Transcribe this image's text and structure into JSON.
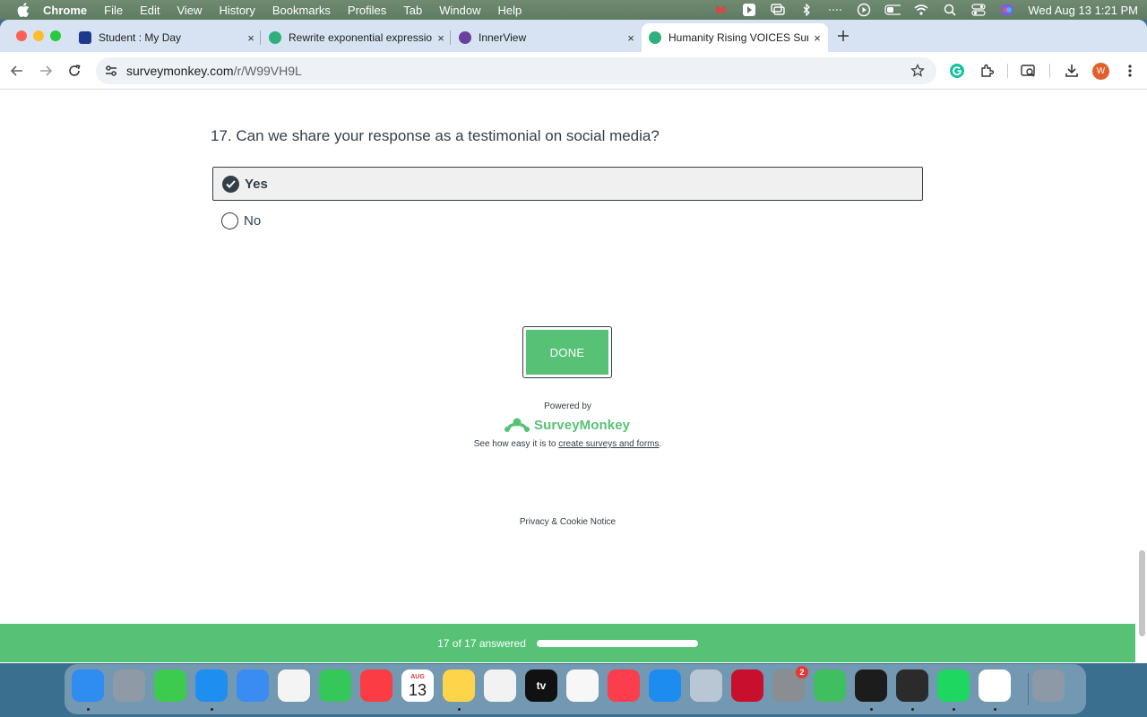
{
  "menubar": {
    "app_name": "Chrome",
    "items": [
      "File",
      "Edit",
      "View",
      "History",
      "Bookmarks",
      "Profiles",
      "Tab",
      "Window",
      "Help"
    ],
    "clock": "Wed Aug 13  1:21 PM"
  },
  "tabs": [
    {
      "title": "Student : My Day",
      "favicon_color": "#1e3a8a"
    },
    {
      "title": "Rewrite exponential expressio",
      "favicon_color": "#2eaf7d"
    },
    {
      "title": "InnerView",
      "favicon_color": "#6b3fa0"
    },
    {
      "title": "Humanity Rising VOICES Surv",
      "favicon_color": "#2eaf7d"
    }
  ],
  "tab_close_glyph": "×",
  "omnibox": {
    "domain": "surveymonkey.com",
    "path": "/r/W99VH9L"
  },
  "profile_initial": "W",
  "survey": {
    "question": "17. Can we share your response as a testimonial on social media?",
    "options": [
      {
        "label": "Yes",
        "selected": true
      },
      {
        "label": "No",
        "selected": false
      }
    ],
    "done_label": "DONE",
    "powered_by": "Powered by",
    "brand": "SurveyMonkey",
    "tagline_prefix": "See how easy it is to ",
    "tagline_link": "create surveys and forms",
    "tagline_suffix": ".",
    "privacy": "Privacy & Cookie Notice"
  },
  "progress": {
    "text": "17 of 17 answered",
    "answered": 17,
    "total": 17,
    "fraction": 1.0
  },
  "colors": {
    "accent_green": "#57c276",
    "text_dark": "#333e48"
  },
  "dock": {
    "apps": [
      {
        "name": "finder",
        "label": "",
        "color": "#2f8cf0"
      },
      {
        "name": "launchpad",
        "label": "",
        "color": "#8e9aa6"
      },
      {
        "name": "messages",
        "label": "",
        "color": "#3ccb4f"
      },
      {
        "name": "safari",
        "label": "",
        "color": "#1f8ef1"
      },
      {
        "name": "mail",
        "label": "",
        "color": "#3b8cf2"
      },
      {
        "name": "photos",
        "label": "",
        "color": "#f4f4f4"
      },
      {
        "name": "facetime",
        "label": "",
        "color": "#35c759"
      },
      {
        "name": "music",
        "label": "",
        "color": "#fc3c44"
      },
      {
        "name": "calendar",
        "label": "13",
        "color": "#ffffff"
      },
      {
        "name": "notes",
        "label": "",
        "color": "#fed54a"
      },
      {
        "name": "freeform",
        "label": "",
        "color": "#f2f2f2"
      },
      {
        "name": "tv",
        "label": "tv",
        "color": "#111111"
      },
      {
        "name": "reminders",
        "label": "",
        "color": "#f7f7f7"
      },
      {
        "name": "news",
        "label": "",
        "color": "#fb3d4d"
      },
      {
        "name": "app-store",
        "label": "",
        "color": "#1d8cf0"
      },
      {
        "name": "preview",
        "label": "",
        "color": "#b9c6d4"
      },
      {
        "name": "mcafee",
        "label": "",
        "color": "#c8102e"
      },
      {
        "name": "system-settings",
        "label": "",
        "color": "#8a8d91",
        "badge": "2"
      },
      {
        "name": "find-my",
        "label": "",
        "color": "#3fbf5f"
      },
      {
        "name": "soundboard",
        "label": "",
        "color": "#1c1c1c"
      },
      {
        "name": "infuse",
        "label": "",
        "color": "#2b2b2b"
      },
      {
        "name": "spotify",
        "label": "",
        "color": "#1ed760"
      },
      {
        "name": "chrome",
        "label": "",
        "color": "#ffffff"
      },
      {
        "name": "trash",
        "label": "",
        "color": "#8d99a6"
      }
    ],
    "calendar_month": "AUG"
  }
}
